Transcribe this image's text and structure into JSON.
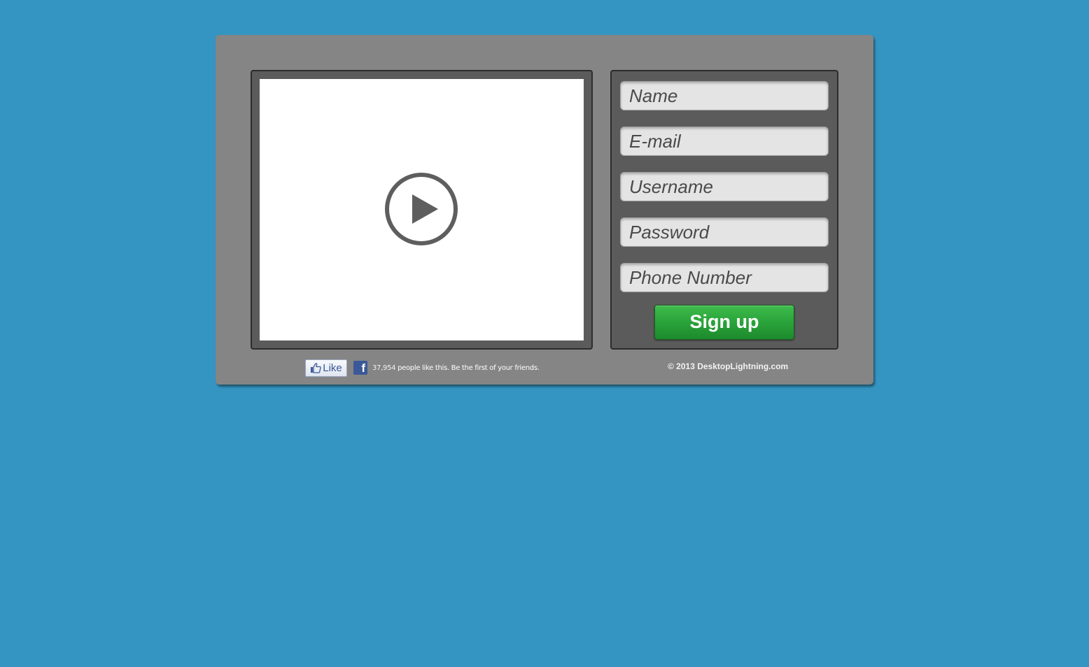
{
  "form": {
    "fields": [
      {
        "placeholder": "Name"
      },
      {
        "placeholder": "E-mail"
      },
      {
        "placeholder": "Username"
      },
      {
        "placeholder": "Password"
      },
      {
        "placeholder": "Phone Number"
      }
    ],
    "submit_label": "Sign up"
  },
  "video": {
    "play_icon": "play-circle-icon"
  },
  "social": {
    "like_label": "Like",
    "facebook_icon_glyph": "f",
    "like_count": "37,954",
    "like_text": " people like this. Be the first of your friends."
  },
  "footer": {
    "copyright": "© 2013 DesktopLightning.com"
  },
  "colors": {
    "background": "#3595c2",
    "panel": "#858585",
    "inner_frame": "#5b5b5b",
    "signup_green": "#2aa33a",
    "facebook_blue": "#3b5998"
  }
}
